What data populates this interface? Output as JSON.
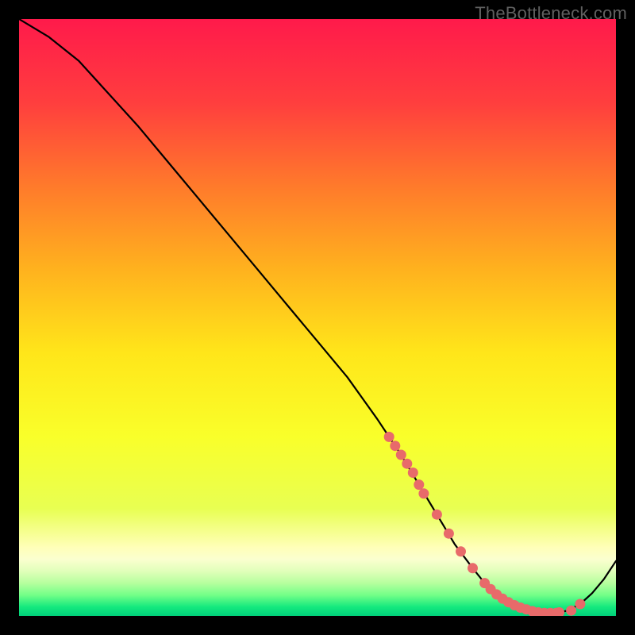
{
  "watermark": "TheBottleneck.com",
  "chart_data": {
    "type": "line",
    "title": "",
    "xlabel": "",
    "ylabel": "",
    "xlim": [
      0,
      100
    ],
    "ylim": [
      0,
      100
    ],
    "grid": false,
    "legend": false,
    "series": [
      {
        "name": "curve",
        "x": [
          0,
          5,
          10,
          15,
          20,
          25,
          30,
          35,
          40,
          45,
          50,
          55,
          60,
          62,
          64,
          67,
          70,
          73,
          76,
          78,
          80,
          82,
          84,
          86,
          88,
          90,
          92,
          94,
          96,
          98,
          100
        ],
        "y": [
          100,
          97,
          93,
          87.5,
          82,
          76,
          70,
          64,
          58,
          52,
          46,
          40,
          33,
          30,
          27,
          22,
          17,
          12,
          8,
          5.5,
          3.6,
          2.3,
          1.4,
          0.8,
          0.5,
          0.5,
          0.9,
          2.0,
          3.8,
          6.2,
          9.2
        ]
      }
    ],
    "markers": {
      "name": "highlight-dots",
      "color": "#e86a6a",
      "x": [
        62,
        63,
        64,
        65,
        66,
        67,
        67.8,
        70,
        72,
        74,
        76,
        78,
        79,
        80,
        81,
        82,
        83,
        84,
        85,
        86,
        87,
        88,
        89,
        90,
        90.5,
        92.5,
        94
      ],
      "y": [
        30,
        28.5,
        27,
        25.5,
        24,
        22,
        20.5,
        17,
        13.8,
        10.8,
        8,
        5.5,
        4.5,
        3.6,
        2.9,
        2.3,
        1.8,
        1.4,
        1.1,
        0.8,
        0.6,
        0.5,
        0.5,
        0.5,
        0.6,
        0.9,
        2.0
      ]
    },
    "gradient_bands": [
      {
        "stop": 0.0,
        "color": "#ff1a4b"
      },
      {
        "stop": 0.14,
        "color": "#ff3e3e"
      },
      {
        "stop": 0.28,
        "color": "#ff7a2b"
      },
      {
        "stop": 0.42,
        "color": "#ffb21e"
      },
      {
        "stop": 0.56,
        "color": "#ffe61a"
      },
      {
        "stop": 0.7,
        "color": "#f9ff2a"
      },
      {
        "stop": 0.82,
        "color": "#e8ff52"
      },
      {
        "stop": 0.885,
        "color": "#ffffb8"
      },
      {
        "stop": 0.905,
        "color": "#fbffcf"
      },
      {
        "stop": 0.925,
        "color": "#e0ffba"
      },
      {
        "stop": 0.945,
        "color": "#b6ff9e"
      },
      {
        "stop": 0.965,
        "color": "#73ff88"
      },
      {
        "stop": 0.985,
        "color": "#14e97e"
      },
      {
        "stop": 1.0,
        "color": "#00d07a"
      }
    ]
  }
}
